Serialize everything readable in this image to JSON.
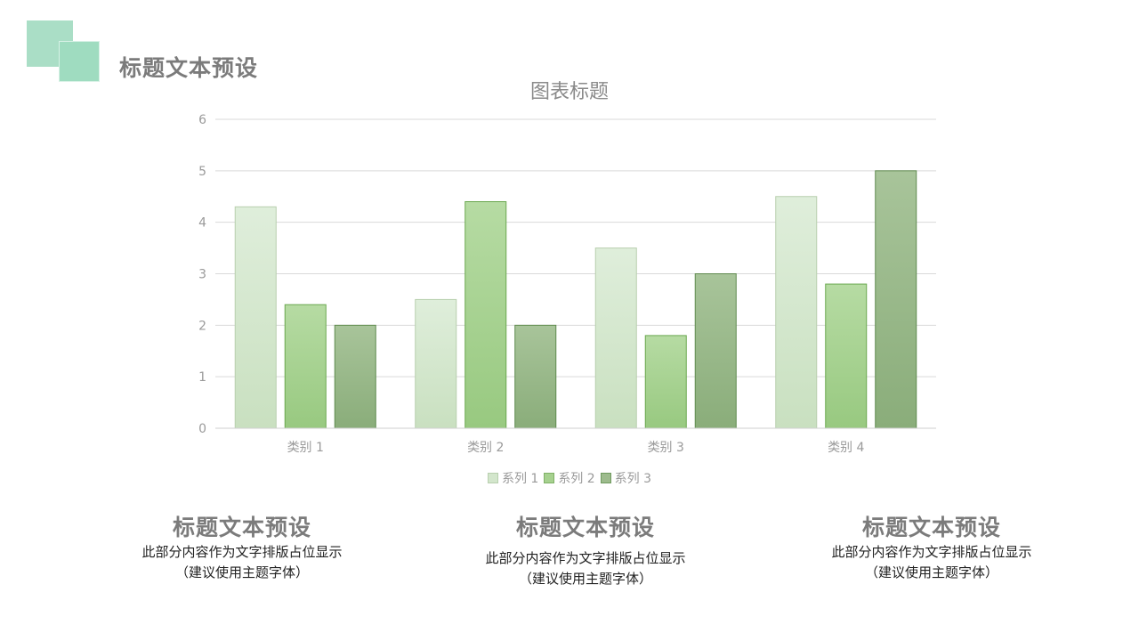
{
  "header": {
    "title": "标题文本预设"
  },
  "chart_data": {
    "type": "bar",
    "title": "图表标题",
    "categories": [
      "类别 1",
      "类别 2",
      "类别 3",
      "类别 4"
    ],
    "series": [
      {
        "name": "系列 1",
        "values": [
          4.3,
          2.5,
          3.5,
          4.5
        ],
        "color": "#d3e6cc"
      },
      {
        "name": "系列 2",
        "values": [
          2.4,
          4.4,
          1.8,
          2.8
        ],
        "color": "#a6d18f"
      },
      {
        "name": "系列 3",
        "values": [
          2.0,
          2.0,
          3.0,
          5.0
        ],
        "color": "#9dbb8d"
      }
    ],
    "ylim": [
      0,
      6
    ],
    "yticks": [
      "0",
      "1",
      "2",
      "3",
      "4",
      "5",
      "6"
    ],
    "grid": true,
    "legend": "bottom"
  },
  "columns": [
    {
      "title": "标题文本预设",
      "line1": "此部分内容作为文字排版占位显示",
      "line2": "（建议使用主题字体）"
    },
    {
      "title": "标题文本预设",
      "line1": "此部分内容作为文字排版占位显示",
      "line2": "（建议使用主题字体）"
    },
    {
      "title": "标题文本预设",
      "line1": "此部分内容作为文字排版占位显示",
      "line2": "（建议使用主题字体）"
    }
  ],
  "colors": {
    "accent": "#a5dcc3",
    "title_text": "#7b7b7b"
  }
}
